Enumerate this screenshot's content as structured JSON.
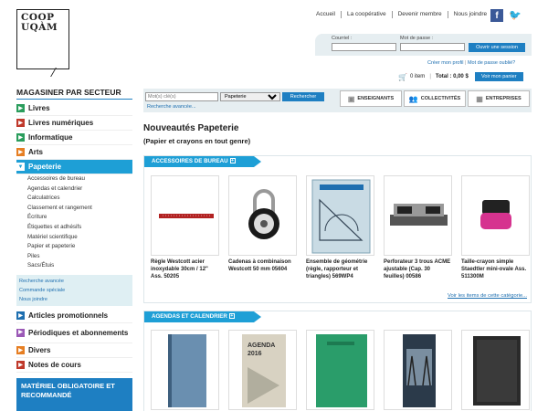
{
  "brand": {
    "line1": "COOP",
    "line2": "UQÀM"
  },
  "topnav": [
    "Accueil",
    "La coopérative",
    "Devenir membre",
    "Nous joindre"
  ],
  "social": {
    "facebook": "f",
    "twitter": "🐦"
  },
  "login": {
    "email_label": "Courriel :",
    "pass_label": "Mot de passe :",
    "submit": "Ouvrir une session",
    "create": "Créer mon profil",
    "forgot": "Mot de passe oublié?",
    "sep": "|"
  },
  "cart": {
    "items": "0 item",
    "total": "Total : 0,00 $",
    "button": "Voir mon panier",
    "sep": "|"
  },
  "sidebar": {
    "title": "MAGASINER PAR SECTEUR",
    "cats": [
      {
        "label": "Livres",
        "color": "#2a9d5c"
      },
      {
        "label": "Livres numériques",
        "color": "#c0392b"
      },
      {
        "label": "Informatique",
        "color": "#2a9d5c"
      },
      {
        "label": "Arts",
        "color": "#e67e22"
      },
      {
        "label": "Papeterie",
        "color": "#1e9fd6"
      }
    ],
    "subcats": [
      "Accessoires de bureau",
      "Agendas et calendrier",
      "Calculatrices",
      "Classement et rangement",
      "Écriture",
      "Étiquettes et adhésifs",
      "Matériel scientifique",
      "Papier et papeterie",
      "Piles",
      "Sacs/Étuis"
    ],
    "quick": [
      "Recherche avancée",
      "Commande spéciale",
      "Nous joindre"
    ],
    "cats2": [
      {
        "label": "Articles promotionnels",
        "color": "#1e6fb0"
      },
      {
        "label": "Périodiques et abonnements",
        "color": "#9b59b6"
      },
      {
        "label": "Divers",
        "color": "#e67e22"
      },
      {
        "label": "Notes de cours",
        "color": "#c0392b"
      }
    ],
    "mandatory": "MATÉRIEL OBLIGATOIRE ET RECOMMANDÉ"
  },
  "search": {
    "placeholder": "Mot(s) clé(s)",
    "select": "Papeterie",
    "button": "Rechercher",
    "advanced": "Recherche avancée..."
  },
  "segments": [
    "ENSEIGNANTS",
    "COLLECTIVITÉS",
    "ENTREPRISES"
  ],
  "main": {
    "title": "Nouveautés Papeterie",
    "subtitle": "(Papier et crayons en tout genre)"
  },
  "sections": [
    {
      "title": "ACCESSOIRES DE BUREAU",
      "see_all": "Voir les items de cette catégorie...",
      "products": [
        "Règle Westcott acier inoxydable 30cm / 12\" Ass. 50205",
        "Cadenas à combinaison Westcott 50 mm 05604",
        "Ensemble de géométrie (règle, rapporteur et triangles) 569WP4",
        "Perforateur 3 trous ACME ajustable (Cap. 30 feuilles) 00586",
        "Taille-crayon simple Staedtler mini-ovale Ass. 511300M"
      ]
    },
    {
      "title": "AGENDAS ET CALENDRIER",
      "see_all": "",
      "agenda_text": "AGENDA 2016"
    }
  ]
}
